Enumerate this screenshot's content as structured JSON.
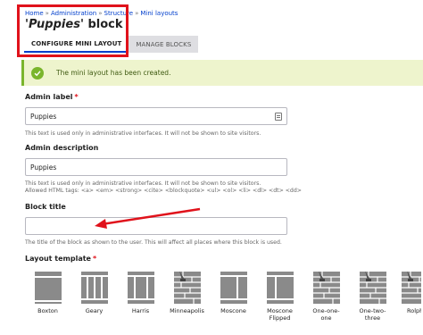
{
  "breadcrumb": {
    "items": [
      "Home",
      "Administration",
      "Structure",
      "Mini layouts"
    ],
    "separator": "»"
  },
  "page_title": {
    "quoted_name": "Puppies",
    "suffix": "block"
  },
  "tabs": [
    {
      "label": "CONFIGURE MINI LAYOUT",
      "active": true
    },
    {
      "label": "MANAGE BLOCKS",
      "active": false
    }
  ],
  "status": {
    "message": "The mini layout has been created.",
    "icon": "checkmark-icon"
  },
  "fields": {
    "admin_label": {
      "label": "Admin label",
      "required_marker": "*",
      "value": "Puppies",
      "help": "This text is used only in administrative interfaces. It will not be shown to site visitors."
    },
    "admin_description": {
      "label": "Admin description",
      "value": "Puppies",
      "help_line1": "This text is used only in administrative interfaces. It will not be shown to site visitors.",
      "help_line2": "Allowed HTML tags: <a> <em> <strong> <cite> <blockquote> <ul> <ol> <li> <dl> <dt> <dd>"
    },
    "block_title": {
      "label": "Block title",
      "value": "",
      "help": "The title of the block as shown to the user. This will affect all places where this block is used."
    },
    "layout_template": {
      "label": "Layout template",
      "required_marker": "*"
    }
  },
  "templates": [
    {
      "label": "Boxton",
      "icon": "boxton-layout-icon"
    },
    {
      "label": "Geary",
      "icon": "geary-layout-icon"
    },
    {
      "label": "Harris",
      "icon": "harris-layout-icon"
    },
    {
      "label": "Minneapolis",
      "icon": "minneapolis-layout-icon"
    },
    {
      "label": "Moscone",
      "icon": "moscone-layout-icon"
    },
    {
      "label": "Moscone Flipped",
      "icon": "moscone-flipped-layout-icon"
    },
    {
      "label": "One-one-one",
      "icon": "one-one-one-layout-icon"
    },
    {
      "label": "One-two-three",
      "icon": "one-two-three-layout-icon"
    },
    {
      "label": "Rolph",
      "icon": "rolph-layout-icon"
    }
  ],
  "colors": {
    "highlight": "#e0121b",
    "status_bg": "#eef4cd",
    "status_accent": "#7ab52c",
    "link": "#003ecc",
    "required": "#e0121b"
  }
}
